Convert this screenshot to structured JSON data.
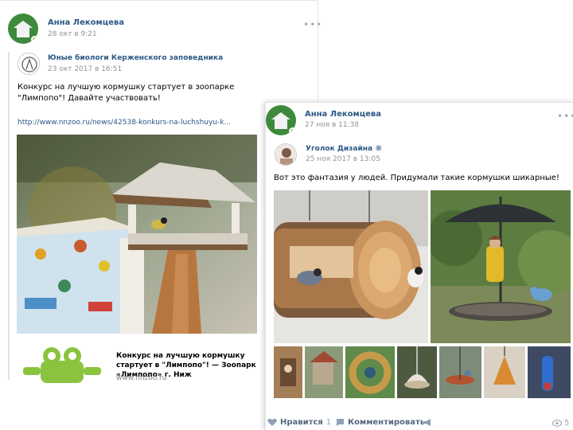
{
  "post1": {
    "author": "Анна Лекомцева",
    "date": "28 окт в 9:21",
    "repost": {
      "source_name": "Юные биологи Керженского заповедника",
      "source_date": "23 окт 2017 в 16:51",
      "text": "Конкурс на лучшую кормушку стартует в зоопарке \"Лимпопо\"! Давайте участвовать!",
      "link": "http://www.nnzoo.ru/news/42538-konkurs-na-luchshuyu-k...",
      "preview_title": "Конкурс на лучшую кормушку стартует в \"Лимпопо\"! — Зоопарк «Лимпопо» г. Ниж",
      "preview_domain": "www.nnzoo.ru"
    }
  },
  "post2": {
    "author": "Анна Лекомцева",
    "date": "27 ноя в 11:38",
    "repost": {
      "source_name": "Уголок Дизайна ®",
      "source_date": "25 ноя 2017 в 13:05",
      "text": "Вот это фантазия у людей. Придумали такие кормушки шикарные!"
    },
    "actions": {
      "like_label": "Нравится",
      "like_count": "1",
      "comment_label": "Комментировать",
      "views": "5"
    }
  },
  "colors": {
    "link": "#2a5885",
    "meta": "#939393",
    "avatar": "#3d8a3c"
  }
}
